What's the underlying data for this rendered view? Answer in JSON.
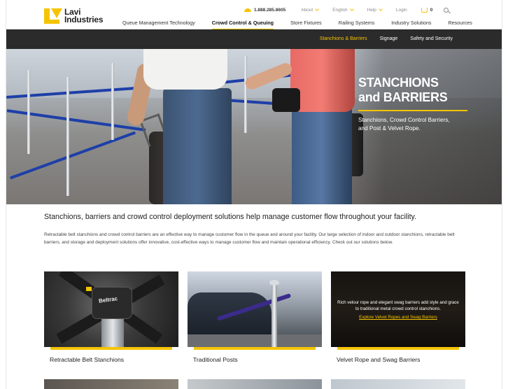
{
  "brand": {
    "name_line1": "Lavi",
    "name_line2": "Industries"
  },
  "utility": {
    "phone": "1.888.285.8605",
    "about": "About",
    "language": "English",
    "help": "Help",
    "login": "Login",
    "cart_count": "0"
  },
  "main_nav": [
    {
      "label": "Queue Management Technology"
    },
    {
      "label": "Crowd Control & Queuing",
      "active": true
    },
    {
      "label": "Store Fixtures"
    },
    {
      "label": "Railing Systems"
    },
    {
      "label": "Industry Solutions"
    },
    {
      "label": "Resources"
    }
  ],
  "sub_nav": [
    {
      "label": "Stanchions & Barriers",
      "active": true
    },
    {
      "label": "Signage"
    },
    {
      "label": "Safety and Security"
    }
  ],
  "hero": {
    "title_line1": "STANCHIONS",
    "title_line2": "and BARRIERS",
    "subtitle_line1": "Stanchions, Crowd Control Barriers,",
    "subtitle_line2": "and Post & Velvet Rope."
  },
  "content": {
    "headline": "Stanchions, barriers and crowd control deployment solutions help manage customer flow throughout your facility.",
    "intro": "Retractable belt stanchions and crowd control barriers are an effective way to manage customer flow in the queue and around your facility. Our large selection of indoor and outdoor stanchions, retractable belt barriers, and storage and deployment solutions offer innovative, cost-effective ways to manage customer flow and maintain operational efficiency. Check out our solutions below."
  },
  "cards": [
    {
      "label": "Retractable Belt Stanchions",
      "product_text": "Beltrac"
    },
    {
      "label": "Traditional Posts"
    },
    {
      "label": "Velvet Rope and Swag Barriers",
      "hover_text": "Rich velour rope and elegant swag barriers add style and grace to traditional metal crowd control stanchions.",
      "hover_link": "Explore Velvet Ropes and Swag Barriers"
    }
  ],
  "colors": {
    "accent": "#f5c400",
    "subnav_bg": "#2b2b2b",
    "text": "#333333",
    "belt_blue": "#1d3fa8"
  }
}
